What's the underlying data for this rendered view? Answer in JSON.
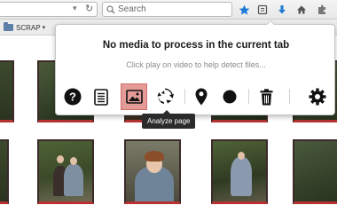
{
  "browser": {
    "search": {
      "placeholder": "Search"
    },
    "bookmarks": {
      "folder_label": "SCRAP"
    }
  },
  "popup": {
    "title": "No media to process in the current tab",
    "subtitle": "Click play on video to help detect files...",
    "buttons": [
      {
        "icon": "help-icon"
      },
      {
        "icon": "list-icon"
      },
      {
        "icon": "image-icon",
        "active": true
      },
      {
        "icon": "convert-icon"
      },
      {
        "icon": "location-pin-icon"
      },
      {
        "icon": "record-icon"
      },
      {
        "icon": "trash-icon"
      },
      {
        "icon": "settings-icon"
      }
    ],
    "tooltip": "Analyze page"
  },
  "colors": {
    "active_button_bg": "#e49b98",
    "thumbnail_border": "#b83232",
    "toolbar_accent": "#1e7ad6"
  }
}
